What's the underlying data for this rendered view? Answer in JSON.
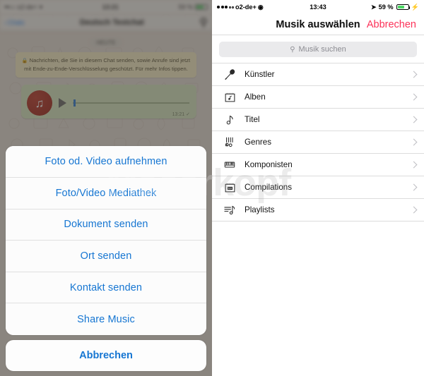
{
  "left_screen": {
    "status_bar": {
      "carrier": "o2-de+",
      "time": "13:21",
      "battery_percent": "59 %",
      "signal_dots": "•••○○",
      "wifi_icon": "wifi-icon"
    },
    "nav_bar": {
      "back_label": "Chats",
      "title": "Deutsch Testchat",
      "search_icon": "search-icon",
      "call_icon": "phone-icon"
    },
    "day_divider": "HEUTE",
    "encryption_notice": {
      "lock_icon": "lock-icon",
      "text": "Nachrichten, die Sie in diesem Chat senden, sowie Anrufe sind jetzt mit Ende-zu-Ende-Verschlüsselung geschützt. Für mehr Infos tippen."
    },
    "voice_message": {
      "avatar_icon": "music-note-icon",
      "play_icon": "play-icon",
      "timestamp": "13:21",
      "read_receipt": "✓",
      "progress_percent": 1
    },
    "action_sheet": {
      "items": [
        {
          "label": "Foto od. Video aufnehmen"
        },
        {
          "label": "Foto/Video Mediathek"
        },
        {
          "label": "Dokument senden"
        },
        {
          "label": "Ort senden"
        },
        {
          "label": "Kontakt senden"
        },
        {
          "label": "Share Music"
        }
      ],
      "cancel_label": "Abbrechen"
    }
  },
  "right_screen": {
    "status_bar": {
      "carrier": "o2-de+",
      "time": "13:43",
      "battery_percent": "59 %",
      "signal_dots": "•••○○",
      "wifi_icon": "wifi-icon",
      "location_icon": "location-arrow-icon",
      "charging_icon": "lightning-bolt-icon"
    },
    "nav_bar": {
      "title": "Musik auswählen",
      "cancel_label": "Abbrechen"
    },
    "search": {
      "placeholder": "Musik suchen",
      "value": "",
      "icon": "search-icon"
    },
    "list_items": [
      {
        "label": "Künstler",
        "icon": "microphone-icon"
      },
      {
        "label": "Alben",
        "icon": "album-icon"
      },
      {
        "label": "Titel",
        "icon": "music-note-icon"
      },
      {
        "label": "Genres",
        "icon": "genres-icon"
      },
      {
        "label": "Komponisten",
        "icon": "piano-keyboard-icon"
      },
      {
        "label": "Compilations",
        "icon": "compilation-icon"
      },
      {
        "label": "Playlists",
        "icon": "playlist-icon"
      }
    ],
    "chevron_icon": "chevron-right-icon"
  },
  "watermark": {
    "text": "Macerkopf"
  },
  "colors": {
    "ios_blue": "#1676D2",
    "cancel_pink": "#FC3158",
    "bubble_green": "#DCEEC5",
    "banner_yellow": "#FCF4CB",
    "battery_green": "#4CD964",
    "avatar_red": "#A8271C"
  }
}
